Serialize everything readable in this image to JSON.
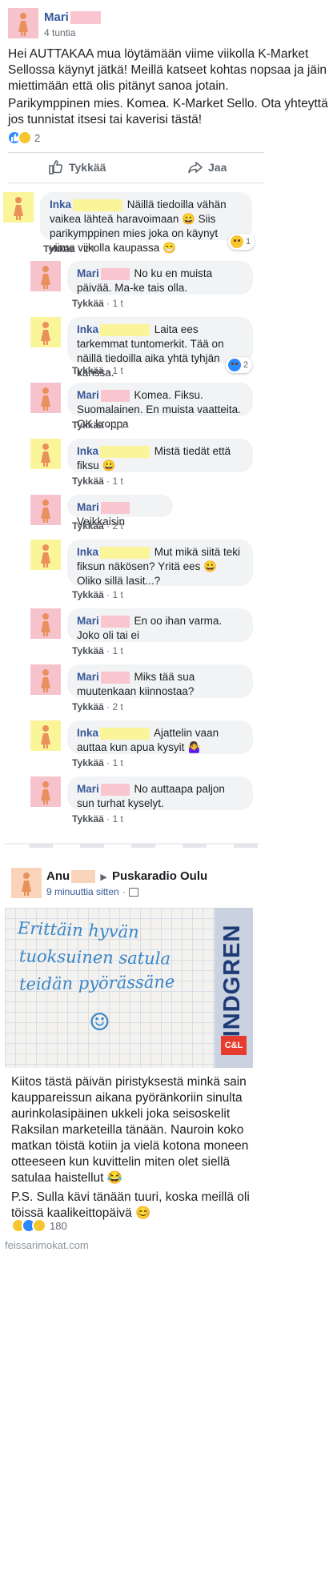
{
  "post": {
    "author_name": "Mari",
    "time": "4 tuntia",
    "paragraph1": "Hei AUTTAKAA mua löytämään viime viikolla K-Market Sellossa käynyt jätkä! Meillä katseet kohtas nopsaa ja jäin miettimään että olis pitänyt sanoa jotain.",
    "paragraph2": "Parikymppinen mies. Komea. K-Market Sello. Ota yhteyttä jos tunnistat itsesi tai kaverisi tästä!",
    "reaction_count": "2",
    "like_label": "Tykkää",
    "share_label": "Jaa"
  },
  "comments": [
    {
      "name": "Inka",
      "text": "Näillä tiedoilla vähän vaikea lähteä haravoimaan 😀 Siis parikymppinen mies joka on käynyt viime viikolla kaupassa 😁",
      "like": "Tykkää",
      "time": "2 t",
      "reaction_count": "1"
    },
    {
      "name": "Mari",
      "text": "No ku en muista päivää. Ma-ke tais olla.",
      "like": "Tykkää",
      "time": "1 t"
    },
    {
      "name": "Inka",
      "text": "Laita ees tarkemmat tuntomerkit. Tää on näillä tiedoilla aika yhtä tyhjän kanssa.",
      "like": "Tykkää",
      "time": "1 t",
      "reaction_count": "2"
    },
    {
      "name": "Mari",
      "text": "Komea. Fiksu. Suomalainen. En muista vaatteita. OK kroppa",
      "like": "Tykkää",
      "time": "1 t"
    },
    {
      "name": "Inka",
      "text": "Mistä tiedät että fiksu 😀",
      "like": "Tykkää",
      "time": "1 t"
    },
    {
      "name": "Mari",
      "text": "Veikkaisin",
      "like": "Tykkää",
      "time": "2 t"
    },
    {
      "name": "Inka",
      "text": "Mut mikä siitä teki fiksun näkösen? Yritä ees 😀 Oliko sillä lasit...?",
      "like": "Tykkää",
      "time": "1 t"
    },
    {
      "name": "Mari",
      "text": "En oo ihan varma. Joko oli tai ei",
      "like": "Tykkää",
      "time": "1 t"
    },
    {
      "name": "Mari",
      "text": "Miks tää sua muutenkaan kiinnostaa?",
      "like": "Tykkää",
      "time": "2 t"
    },
    {
      "name": "Inka",
      "text": "Ajattelin vaan auttaa kun apua kysyit 🤷‍♀️",
      "like": "Tykkää",
      "time": "1 t"
    },
    {
      "name": "Mari",
      "text": "No auttaapa paljon sun turhat kyselyt.",
      "like": "Tykkää",
      "time": "1 t"
    }
  ],
  "post2": {
    "author_name": "Anu",
    "group_name": "Puskaradio Oulu",
    "time": "9 minuuttia sitten",
    "separator": "·",
    "handwritten": [
      "Erittäin hyvän",
      "tuoksuinen satula",
      "teidän pyörässäne",
      "☺"
    ],
    "brand": "LINDGREN",
    "brand_small": "C&L",
    "paragraph1": "Kiitos tästä päivän piristyksestä minkä sain kauppareissun aikana pyöränkoriin sinulta aurinkolasipäinen ukkeli joka seisoskelit Raksilan marketeilla tänään. Nauroin koko matkan töistä kotiin ja vielä kotona moneen otteeseen kun kuvittelin miten olet siellä satulaa haistellut 😂",
    "paragraph2": "P.S. Sulla kävi tänään tuuri, koska meillä oli töissä kaalikeittopäivä 😊",
    "reaction_count": "180"
  },
  "watermark": "feissarimokat.com",
  "colors": {
    "link": "#365899",
    "pink_redact": "#f9c6d0",
    "yellow_redact": "#fbf59a",
    "bubble": "#f2f3f5",
    "like_blue": "#2d88ff"
  }
}
